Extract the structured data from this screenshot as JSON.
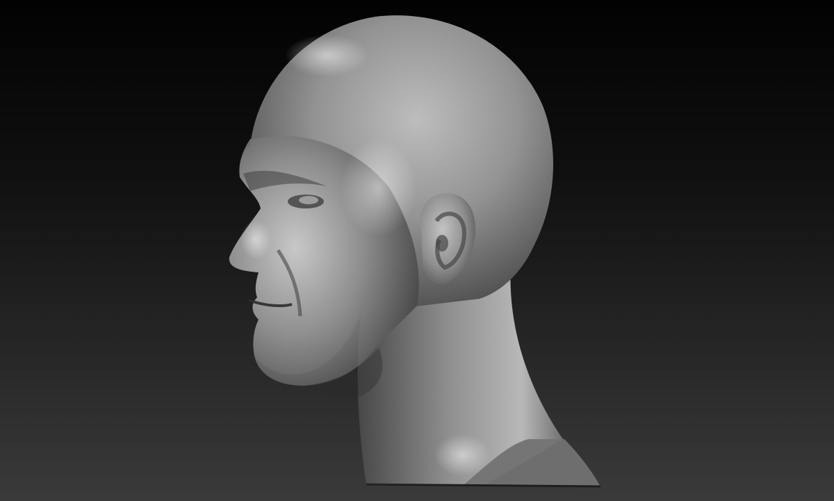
{
  "scene": {
    "subject": "sculpted-male-head-profile",
    "colors": {
      "bg_top": "#020202",
      "bg_bottom": "#3a3a3a",
      "clay_highlight": "#e8e8e8",
      "clay_mid": "#8d8d8d",
      "clay_shadow": "#2a2a2a",
      "base_cap": "#6e6e6e"
    }
  }
}
